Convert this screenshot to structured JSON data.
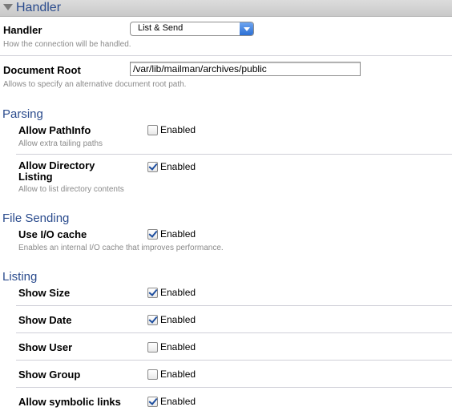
{
  "header": {
    "title": "Handler"
  },
  "handler": {
    "label": "Handler",
    "selected": "List & Send",
    "hint": "How the connection will be handled."
  },
  "docroot": {
    "label": "Document Root",
    "value": "/var/lib/mailman/archives/public",
    "hint": "Allows to specify an alternative document root path."
  },
  "parsing": {
    "title": "Parsing",
    "pathinfo": {
      "label": "Allow PathInfo",
      "checkbox_label": "Enabled",
      "checked": false,
      "hint": "Allow extra tailing paths"
    },
    "dirlist": {
      "label_line1": "Allow Directory",
      "label_line2": "Listing",
      "checkbox_label": "Enabled",
      "checked": true,
      "hint": "Allow to list directory contents"
    }
  },
  "filesending": {
    "title": "File Sending",
    "iocache": {
      "label": "Use I/O cache",
      "checkbox_label": "Enabled",
      "checked": true,
      "hint": "Enables an internal I/O cache that improves performance."
    }
  },
  "listing": {
    "title": "Listing",
    "size": {
      "label": "Show Size",
      "checkbox_label": "Enabled",
      "checked": true
    },
    "date": {
      "label": "Show Date",
      "checkbox_label": "Enabled",
      "checked": true
    },
    "user": {
      "label": "Show User",
      "checkbox_label": "Enabled",
      "checked": false
    },
    "group": {
      "label": "Show Group",
      "checkbox_label": "Enabled",
      "checked": false
    },
    "symlinks": {
      "label": "Allow symbolic links",
      "checkbox_label": "Enabled",
      "checked": true
    }
  },
  "colors": {
    "section_title": "#2a4b8d",
    "hint": "#8a8a8a",
    "header_bg": "#d4d4d4"
  }
}
